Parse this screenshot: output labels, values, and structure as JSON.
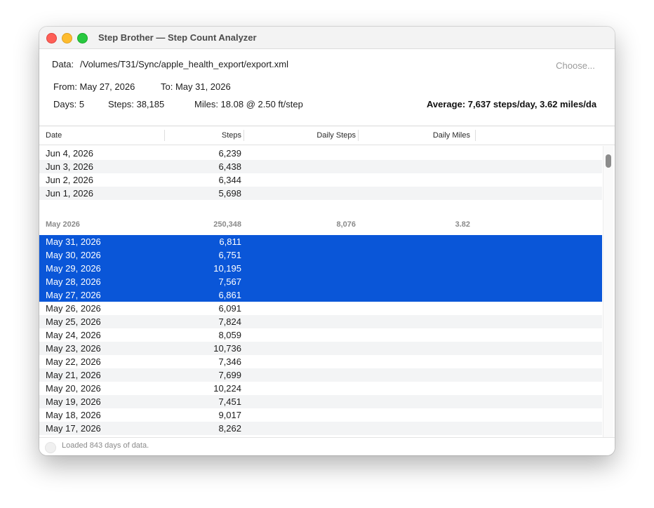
{
  "window": {
    "title": "Step Brother — Step Count Analyzer"
  },
  "header": {
    "data_label": "Data:",
    "data_path": "/Volumes/T31/Sync/apple_health_export/export.xml",
    "choose_label": "Choose...",
    "from_label": "From: May 27, 2026",
    "to_label": "To: May 31, 2026",
    "days_label": "Days: 5",
    "steps_label": "Steps: 38,185",
    "miles_label": "Miles: 18.08 @ 2.50 ft/step",
    "average_label": "Average: 7,637 steps/day, 3.62 miles/da"
  },
  "table": {
    "columns": [
      "Date",
      "Steps",
      "Daily Steps",
      "Daily Miles"
    ],
    "rows_top": [
      {
        "date": "Jun 4, 2026",
        "steps": "6,239"
      },
      {
        "date": "Jun 3, 2026",
        "steps": "6,438"
      },
      {
        "date": "Jun 2, 2026",
        "steps": "6,344"
      },
      {
        "date": "Jun 1, 2026",
        "steps": "5,698"
      }
    ],
    "group": {
      "label": "May 2026",
      "steps": "250,348",
      "daily_steps": "8,076",
      "daily_miles": "3.82"
    },
    "rows_selected": [
      {
        "date": "May 31, 2026",
        "steps": "6,811"
      },
      {
        "date": "May 30, 2026",
        "steps": "6,751"
      },
      {
        "date": "May 29, 2026",
        "steps": "10,195"
      },
      {
        "date": "May 28, 2026",
        "steps": "7,567"
      },
      {
        "date": "May 27, 2026",
        "steps": "6,861"
      }
    ],
    "rows_rest": [
      {
        "date": "May 26, 2026",
        "steps": "6,091"
      },
      {
        "date": "May 25, 2026",
        "steps": "7,824"
      },
      {
        "date": "May 24, 2026",
        "steps": "8,059"
      },
      {
        "date": "May 23, 2026",
        "steps": "10,736"
      },
      {
        "date": "May 22, 2026",
        "steps": "7,346"
      },
      {
        "date": "May 21, 2026",
        "steps": "7,699"
      },
      {
        "date": "May 20, 2026",
        "steps": "10,224"
      },
      {
        "date": "May 19, 2026",
        "steps": "7,451"
      },
      {
        "date": "May 18, 2026",
        "steps": "9,017"
      },
      {
        "date": "May 17, 2026",
        "steps": "8,262"
      }
    ]
  },
  "status": {
    "text": "Loaded 843 days of data."
  }
}
